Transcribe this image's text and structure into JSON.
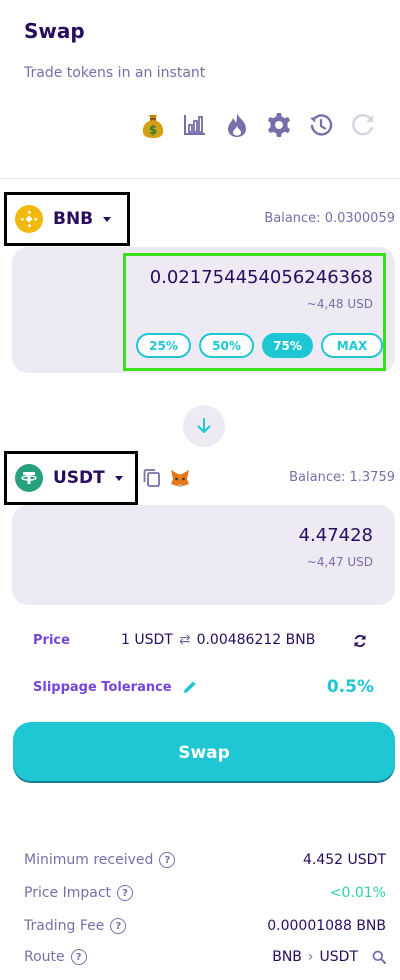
{
  "header": {
    "title": "Swap",
    "subtitle": "Trade tokens in an instant"
  },
  "toolbar": {
    "icons": [
      "money-bag-icon",
      "chart-icon",
      "fire-icon",
      "gear-icon",
      "history-icon",
      "refresh-icon"
    ]
  },
  "from": {
    "symbol": "BNB",
    "balance": "Balance: 0.0300059",
    "amount": "0.021754454056246368",
    "usd": "~4,48 USD",
    "percent_buttons": [
      "25%",
      "50%",
      "75%",
      "MAX"
    ],
    "active_percent": "75%"
  },
  "to": {
    "symbol": "USDT",
    "balance": "Balance: 1.3759",
    "amount": "4.47428",
    "usd": "~4,47 USD"
  },
  "price": {
    "label": "Price",
    "left": "1 USDT",
    "right": "0.00486212 BNB"
  },
  "slippage": {
    "label": "Slippage Tolerance",
    "value": "0.5%"
  },
  "swap_button": "Swap",
  "summary": {
    "minimum_received_label": "Minimum received",
    "minimum_received_value": "4.452 USDT",
    "price_impact_label": "Price Impact",
    "price_impact_value": "<0.01%",
    "trading_fee_label": "Trading Fee",
    "trading_fee_value": "0.00001088 BNB",
    "route_label": "Route",
    "route_from": "BNB",
    "route_to": "USDT"
  },
  "colors": {
    "primary": "#1fc7d4",
    "text": "#280d5f",
    "text_subtle": "#7a6eaa",
    "secondary": "#7645d9",
    "success": "#31d0aa",
    "panel": "#eeeaf4"
  }
}
